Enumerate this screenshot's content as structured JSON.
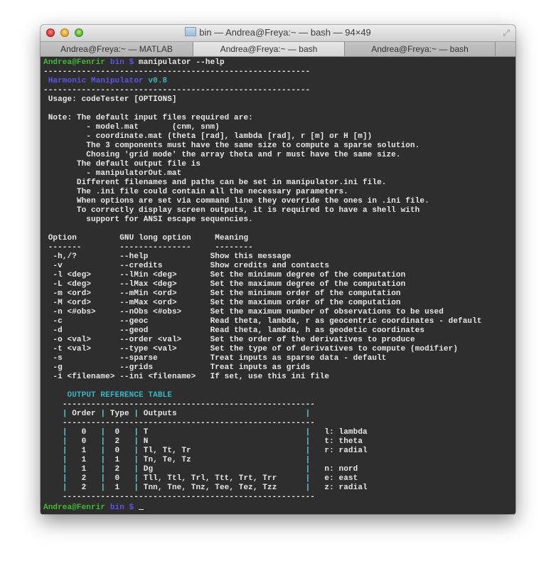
{
  "window": {
    "title": "bin — Andrea@Freya:~ — bash — 94×49",
    "icons": {
      "close": "close-icon",
      "minimize": "minimize-icon",
      "zoom": "zoom-icon",
      "folder": "folder-icon",
      "fullscreen": "fullscreen-icon"
    }
  },
  "tabs": [
    {
      "label": "Andrea@Freya:~ — MATLAB",
      "active": false
    },
    {
      "label": "Andrea@Freya:~ — bash",
      "active": true
    },
    {
      "label": "Andrea@Freya:~ — bash",
      "active": false
    }
  ],
  "prompt": {
    "user_host": "Andrea@Fenrir",
    "dir": "bin",
    "symbol": "$"
  },
  "command": "manipulator --help",
  "separator": "--------------------------------------------------------",
  "banner": {
    "name": "Harmonic Manipulator",
    "version": "v0.8"
  },
  "usage": " Usage: codeTester [OPTIONS]",
  "notes": [
    " Note: The default input files required are:",
    "         - model.mat       (cnm, snm)",
    "         - coordinate.mat (theta [rad], lambda [rad], r [m] or H [m])",
    "         The 3 components must have the same size to compute a sparse solution.",
    "         Chosing 'grid mode' the array theta and r must have the same size.",
    "       The default output file is",
    "         - manipulatorOut.mat",
    "       Different filenames and paths can be set in manipulator.ini file.",
    "       The .ini file could contain all the necessary parameters.",
    "       When options are set via command line they override the ones in .ini file.",
    "       To correctly display screen outputs, it is required to have a shell with",
    "         support for ANSI escape sequencies."
  ],
  "options_header": {
    "option": "Option",
    "long": "GNU long option",
    "meaning": "Meaning",
    "u1": "-------",
    "u2": "---------------",
    "u3": "--------"
  },
  "options": [
    {
      "short": "-h,/?",
      "long": "--help",
      "meaning": "Show this message"
    },
    {
      "short": "-v",
      "long": "--credits",
      "meaning": "Show credits and contacts"
    },
    {
      "short": "-l <deg>",
      "long": "--lMin <deg>",
      "meaning": "Set the minimum degree of the computation"
    },
    {
      "short": "-L <deg>",
      "long": "--lMax <deg>",
      "meaning": "Set the maximum degree of the computation"
    },
    {
      "short": "-m <ord>",
      "long": "--mMin <ord>",
      "meaning": "Set the minimum order of the computation"
    },
    {
      "short": "-M <ord>",
      "long": "--mMax <ord>",
      "meaning": "Set the maximum order of the computation"
    },
    {
      "short": "-n <#obs>",
      "long": "--nObs <#obs>",
      "meaning": "Set the maximum number of observations to be used"
    },
    {
      "short": "-c",
      "long": "--geoc",
      "meaning": "Read theta, lambda, r as geocentric coordinates - default"
    },
    {
      "short": "-d",
      "long": "--geod",
      "meaning": "Read theta, lambda, h as geodetic coordinates"
    },
    {
      "short": "-o <val>",
      "long": "--order <val>",
      "meaning": "Set the order of the derivatives to produce"
    },
    {
      "short": "-t <val>",
      "long": "--type <val>",
      "meaning": "Set the type of of derivatives to compute (modifier)"
    },
    {
      "short": "-s",
      "long": "--sparse",
      "meaning": "Treat inputs as sparse data - default"
    },
    {
      "short": "-g",
      "long": "--grids",
      "meaning": "Treat inputs as grids"
    },
    {
      "short": "-i <filename>",
      "long": "--ini <filename>",
      "meaning": "If set, use this ini file"
    }
  ],
  "ref_table": {
    "title": "OUTPUT REFERENCE TABLE",
    "rule": "-----------------------------------------------------",
    "headers": {
      "order": "Order",
      "type": "Type",
      "outputs": "Outputs"
    },
    "rows": [
      {
        "order": "0",
        "type": "0",
        "outputs": "T",
        "legend": "l: lambda"
      },
      {
        "order": "0",
        "type": "2",
        "outputs": "N",
        "legend": "t: theta"
      },
      {
        "order": "1",
        "type": "0",
        "outputs": "Tl, Tt, Tr",
        "legend": "r: radial"
      },
      {
        "order": "1",
        "type": "1",
        "outputs": "Tn, Te, Tz",
        "legend": ""
      },
      {
        "order": "1",
        "type": "2",
        "outputs": "Dg",
        "legend": "n: nord"
      },
      {
        "order": "2",
        "type": "0",
        "outputs": "Tll, Ttl, Trl, Ttt, Trt, Trr",
        "legend": "e: east"
      },
      {
        "order": "2",
        "type": "1",
        "outputs": "Tnn, Tne, Tnz, Tee, Tez, Tzz",
        "legend": "z: radial"
      }
    ]
  },
  "colors": {
    "prompt_user": "#3dbb35",
    "prompt_dir": "#5a55e8",
    "banner": "#5a55e8",
    "version": "#3ab5c0",
    "table_title": "#3ab5c0",
    "background": "#2e2e2e",
    "text": "#e8e8e8"
  }
}
